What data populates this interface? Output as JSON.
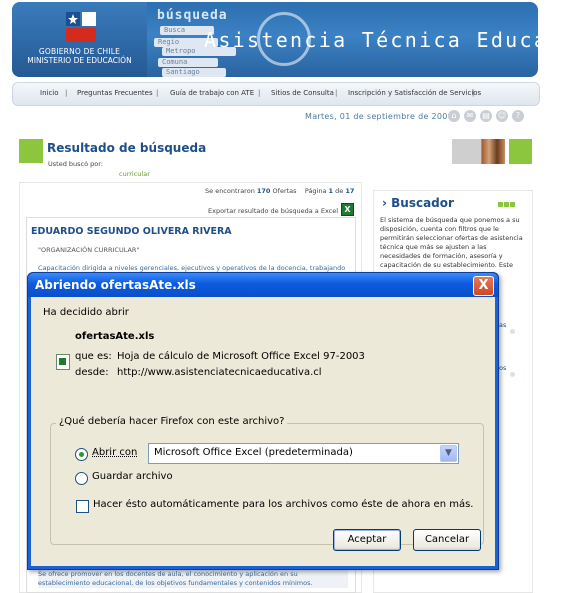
{
  "header": {
    "gov_line1": "GOBIERNO DE CHILE",
    "gov_line2": "MINISTERIO DE EDUCACIÓN",
    "site_title": "Asistencia Técnica Educativa",
    "ghost_search": "búsqueda",
    "ghost_fields": [
      "Busca",
      "Regio",
      "Metropo",
      "Comuna",
      "Santiago"
    ]
  },
  "nav": {
    "items": [
      "Inicio",
      "Preguntas Frecuentes",
      "Guía de trabajo con ATE",
      "Sitios de Consulta",
      "Inscripción y Satisfacción de Servicios"
    ]
  },
  "date": "Martes, 01 de septiembre de 2009",
  "toolbar_icons": [
    "home-icon",
    "mail-icon",
    "print-icon",
    "accessibility-icon",
    "help-icon"
  ],
  "results": {
    "title": "Resultado de búsqueda",
    "you_searched": "Usted buscó por:",
    "query": "curricular",
    "count_prefix": "Se encontraron",
    "count": "170",
    "count_suffix": "Ofertas",
    "page_label": "Página",
    "page_current": "1",
    "page_of": "de",
    "page_total": "17",
    "export_label": "Exportar resultado de búsqueda a Excel",
    "entry_name": "EDUARDO SEGUNDO OLIVERA RIVERA",
    "entry_org": "\"ORGANIZACIÓN CURRICULAR\"",
    "entry_desc": "Capacitación dirigida a niveles gerenciales, ejecutivos y operativos de la docencia, trabajando",
    "entry_bottom": "Se ofrece promover en los docentes de aula, el conocimiento y aplicación en su establecimiento educacional, de los objetivos fundamentales y contenidos mínimos."
  },
  "sidebar": {
    "title": "Buscador",
    "text": "El sistema de búsqueda que ponemos a su disposición, cuenta con filtros que le permitirán seleccionar ofertas de asistencia técnica que más se ajusten a las necesidades de formación, asesoría y capacitación de su establecimiento. Este",
    "frag1": "as",
    "frag2": "os"
  },
  "dialog": {
    "title": "Abriendo ofertasAte.xls",
    "close_label": "X",
    "intro": "Ha decidido abrir",
    "filename": "ofertasAte.xls",
    "type_label": "que es:",
    "type_value": "Hoja de cálculo de Microsoft Office Excel 97-2003",
    "from_label": "desde:",
    "from_value": "http://www.asistenciatecnicaeducativa.cl",
    "question": "¿Qué debería hacer Firefox con este archivo?",
    "open_with_label": "Abrir con",
    "open_with_value": "Microsoft Office Excel (predeterminada)",
    "save_label": "Guardar archivo",
    "auto_label": "Hacer ésto automáticamente para los archivos como éste de ahora en más.",
    "ok_label": "Aceptar",
    "cancel_label": "Cancelar",
    "selected_option": "Abrir con",
    "auto_checked": false
  },
  "colors": {
    "xp_title_blue": "#0b5be0",
    "dialog_face": "#ece9d8",
    "site_blue": "#1e4f8a",
    "site_green": "#8cc63f"
  }
}
